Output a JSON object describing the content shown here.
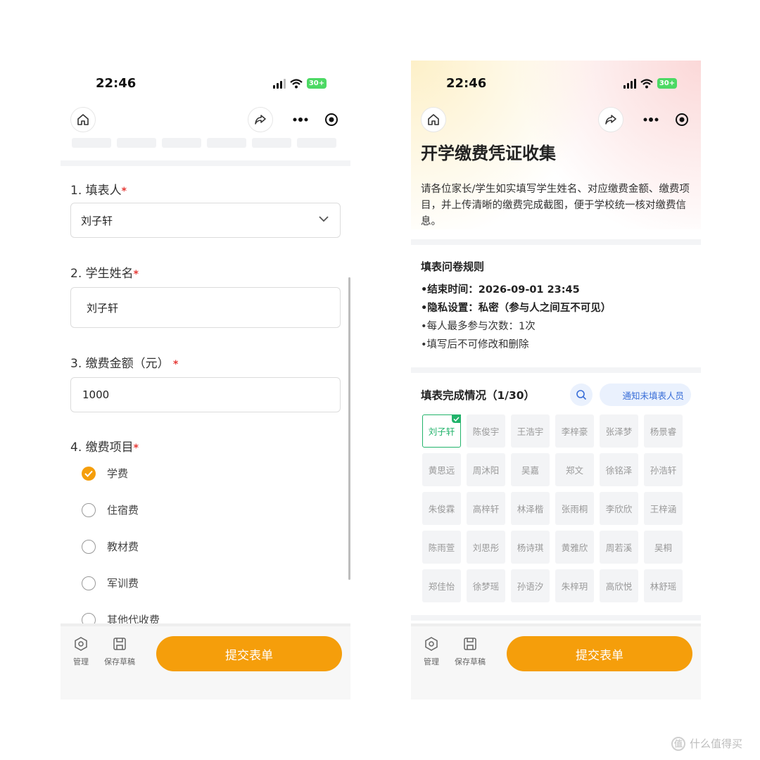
{
  "status_bar": {
    "time": "22:46",
    "battery": "30+"
  },
  "left_screen": {
    "questions": [
      {
        "label": "1. 填表人",
        "value": "刘子轩"
      },
      {
        "label": "2. 学生姓名",
        "value": "刘子轩"
      },
      {
        "label": "3. 缴费金额（元）",
        "value": "1000"
      },
      {
        "label": "4. 缴费项目"
      }
    ],
    "required_mark": "*",
    "fee_options": [
      {
        "label": "学费",
        "checked": true
      },
      {
        "label": "住宿费",
        "checked": false
      },
      {
        "label": "教材费",
        "checked": false
      },
      {
        "label": "军训费",
        "checked": false
      },
      {
        "label": "其他代收费",
        "checked": false
      }
    ]
  },
  "right_screen": {
    "title": "开学缴费凭证收集",
    "intro": "请各位家长/学生如实填写学生姓名、对应缴费金额、缴费项目，并上传清晰的缴费完成截图，便于学校统一核对缴费信息。",
    "rules_title": "填表问卷规则",
    "rules": [
      "•结束时间：2026-09-01 23:45",
      "•隐私设置：私密（参与人之间互不可见）",
      "•每人最多参与次数：1次",
      "•填写后不可修改和删除"
    ],
    "progress_title": "填表完成情况（1/30）",
    "notify_button": "通知未填表人员",
    "completed_count": 1,
    "total_count": 30,
    "names": [
      "刘子轩",
      "陈俊宇",
      "王浩宇",
      "李梓豪",
      "张泽梦",
      "杨景睿",
      "黄思远",
      "周沐阳",
      "吴嘉",
      "郑文",
      "徐铭泽",
      "孙浩轩",
      "朱俊霖",
      "高梓轩",
      "林泽楷",
      "张雨桐",
      "李欣欣",
      "王梓涵",
      "陈雨萱",
      "刘思彤",
      "杨诗琪",
      "黄雅欣",
      "周若溪",
      "吴桐",
      "郑佳怡",
      "徐梦瑶",
      "孙语汐",
      "朱梓玥",
      "高欣悦",
      "林舒瑶"
    ]
  },
  "bottom_bar": {
    "manage_label": "管理",
    "draft_label": "保存草稿",
    "submit_label": "提交表单"
  },
  "watermark": {
    "text": "什么值得买",
    "logo_char": "值"
  },
  "colors": {
    "accent": "#f59e0b",
    "done": "#22b36b",
    "link": "#3a6fd8",
    "required": "#e53935"
  }
}
